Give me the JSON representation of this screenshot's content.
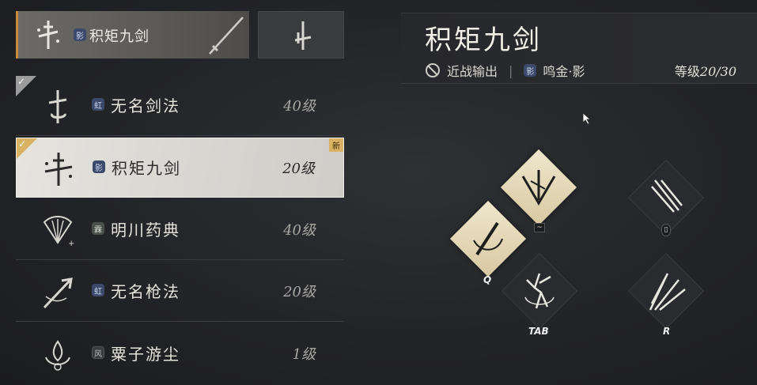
{
  "top_slot": {
    "name": "积矩九剑",
    "badge": "影"
  },
  "list": [
    {
      "name": "无名剑法",
      "level": "40级",
      "badge": "虹",
      "checked": true
    },
    {
      "name": "积矩九剑",
      "level": "20级",
      "badge": "影",
      "checked": true,
      "selected": true,
      "tag": "新"
    },
    {
      "name": "明川药典",
      "level": "40级",
      "badge": "霖"
    },
    {
      "name": "无名枪法",
      "level": "20级",
      "badge": "虹"
    },
    {
      "name": "粟子游尘",
      "level": "1级",
      "badge": "风"
    }
  ],
  "detail": {
    "title": "积矩九剑",
    "role": "近战输出",
    "school_badge": "影",
    "school": "鸣金·影",
    "grade_label": "等级",
    "grade_value": "20/30"
  },
  "skills": {
    "tilde_key": "~",
    "q_key": "Q",
    "tab_key": "TAB",
    "r_key": "R",
    "mouse_key": "▯"
  },
  "colors": {
    "accent": "#c98a3c",
    "selected_bg": "#e0ded9",
    "gold": "#d9b263"
  }
}
